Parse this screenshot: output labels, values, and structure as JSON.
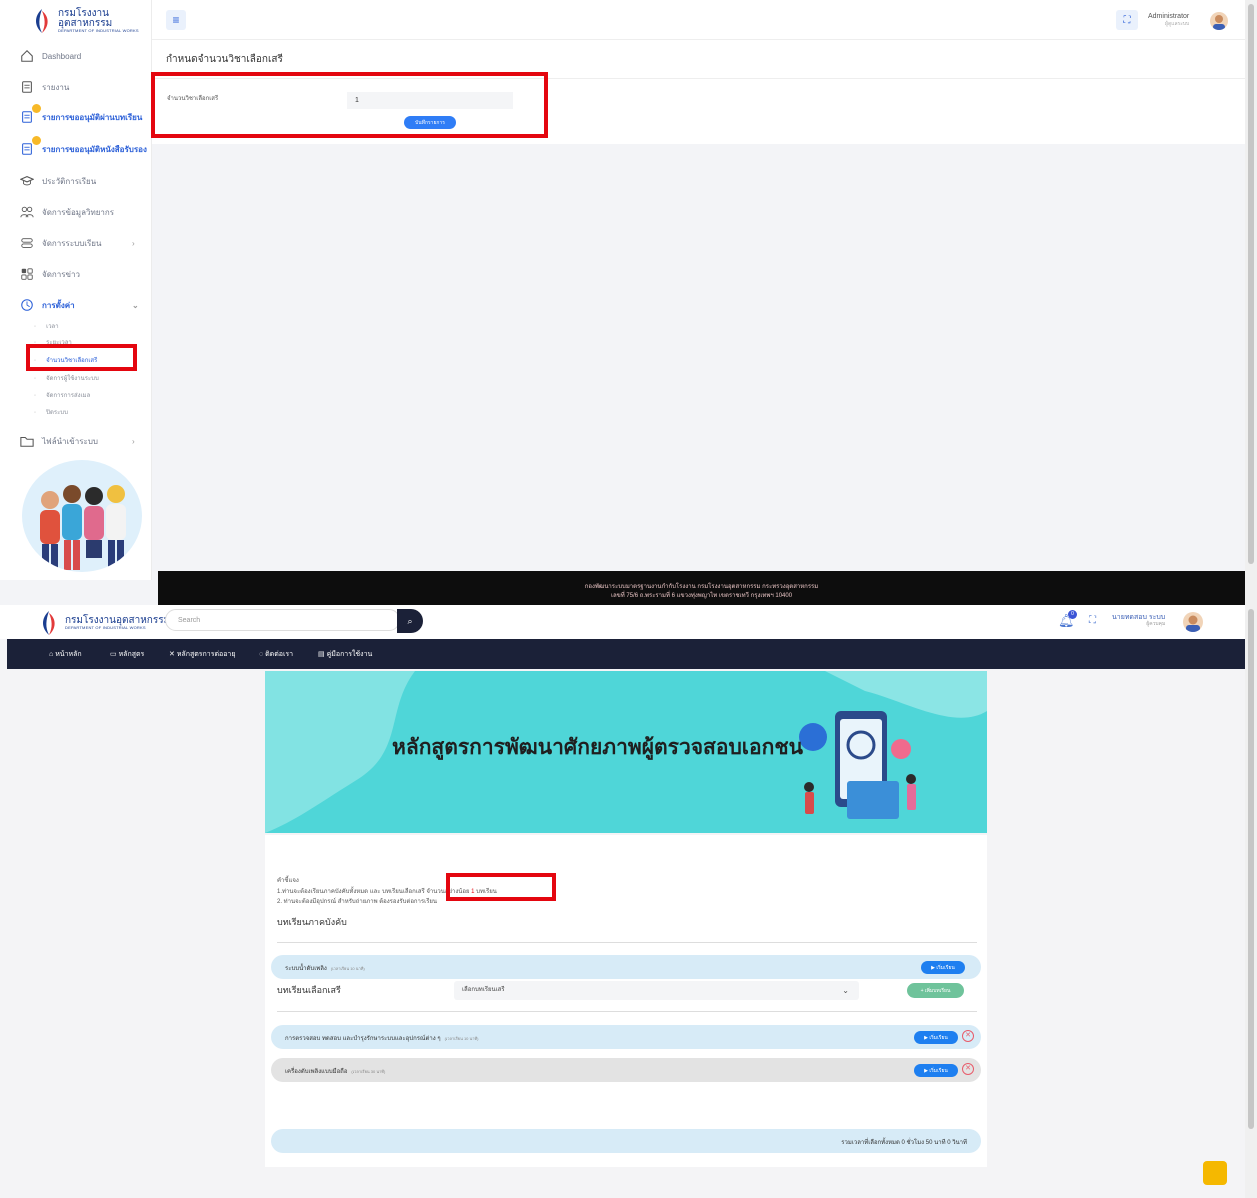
{
  "admin": {
    "logo": {
      "name": "กรมโรงงานอุตสาหกรรม",
      "sub": "DEPARTMENT OF INDUSTRIAL WORKS"
    },
    "sidebar": {
      "items": [
        {
          "label": "Dashboard"
        },
        {
          "label": "รายงาน"
        },
        {
          "label": "รายการขออนุมัติผ่านบทเรียน"
        },
        {
          "label": "รายการขออนุมัติหนังสือรับรอง"
        },
        {
          "label": "ประวัติการเรียน"
        },
        {
          "label": "จัดการข้อมูลวิทยากร"
        },
        {
          "label": "จัดการระบบเรียน"
        },
        {
          "label": "จัดการข่าว"
        },
        {
          "label": "การตั้งค่า"
        },
        {
          "label": "ไฟล์นำเข้าระบบ"
        }
      ],
      "sub_items": [
        {
          "label": "เวลา"
        },
        {
          "label": "ระยะเวลา"
        },
        {
          "label": "จำนวนวิชาเลือกเสรี"
        },
        {
          "label": "จัดการผู้ใช้งานระบบ"
        },
        {
          "label": "จัดการการส่งเมล"
        },
        {
          "label": "ปิดระบบ"
        }
      ]
    },
    "topbar": {
      "user": "Administrator",
      "role": "ผู้ดูแลระบบ"
    },
    "content": {
      "title": "กำหนดจำนวนวิชาเลือกเสรี",
      "field_label": "จำนวนวิชาเลือกเสรี",
      "field_value": "1",
      "save_label": "บันทึกรายการ"
    },
    "footer": {
      "line1": "กองพัฒนาระบบมาตรฐานงานกำกับโรงงาน กรมโรงงานอุตสาหกรรม กระทรวงอุตสาหกรรม",
      "line2": "เลขที่ 75/6 ถ.พระรามที่ 6 แขวงทุ่งพญาไท เขตราชเทวี กรุงเทพฯ 10400"
    }
  },
  "learner": {
    "logo": {
      "name": "กรมโรงงานอุตสาหกรรม",
      "sub": "DEPARTMENT OF INDUSTRIAL WORKS"
    },
    "search_placeholder": "Search",
    "bell_count": "0",
    "user": {
      "name": "นายทดสอบ ระบบ",
      "role": "ผู้ควบคุม"
    },
    "nav": [
      "หน้าหลัก",
      "หลักสูตร",
      "หลักสูตรการต่ออายุ",
      "ติดต่อเรา",
      "คู่มือการใช้งาน"
    ],
    "banner_title": "หลักสูตรการพัฒนาศักยภาพผู้ตรวจสอบเอกชน",
    "notes": {
      "heading": "คำชี้แจง",
      "line1_a": "1.ท่านจะต้องเรียนภาคบังคับทั้งหมด และ บทเรียนเลือกเสรี จำนวนอย่างน้อย ",
      "line1_count": "1",
      "line1_b": " บทเรียน",
      "line2": "2. ท่านจะต้องมีอุปกรณ์ สำหรับถ่ายภาพ ต้องรองรับต่อการเรียน"
    },
    "mandatory_title": "บทเรียนภาคบังคับ",
    "mandatory": [
      {
        "title": "ระบบน้ำดับเพลิง",
        "duration": "(เวลาเรียน 10 นาที)"
      }
    ],
    "elective_title": "บทเรียนเลือกเสรี",
    "select_placeholder": "เลือกบทเรียนเสรี",
    "add_label": "+ เพิ่มบทเรียน",
    "electives": [
      {
        "title": "การตรวจสอบ ทดสอบ และบำรุงรักษาระบบและอุปกรณ์ต่าง ๆ",
        "duration": "(เวลาเรียน 10 นาที)"
      },
      {
        "title": "เครื่องดับเพลิงแบบมือถือ",
        "duration": "(เวลาเรียน 30 นาที)"
      }
    ],
    "start_label": "▶ เริ่มเรียน",
    "total": "รวมเวลาที่เลือกทั้งหมด 0 ชั่วโมง 50 นาที 0 วินาที"
  }
}
